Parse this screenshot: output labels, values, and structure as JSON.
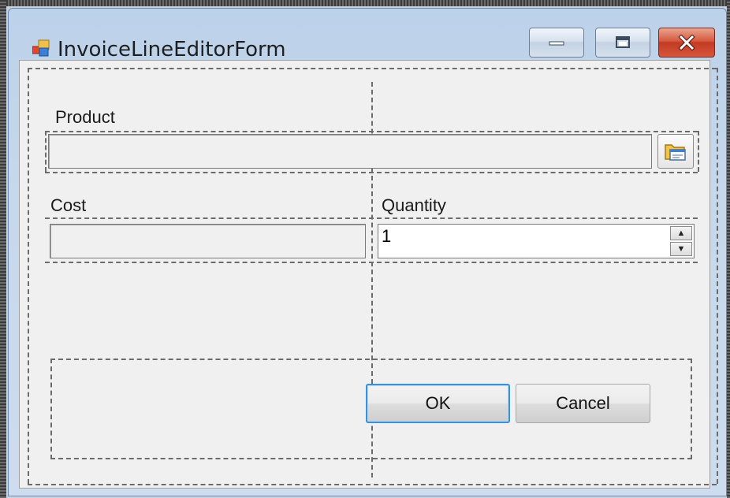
{
  "window": {
    "title": "InvoiceLineEditorForm",
    "controls": {
      "minimize_icon": "minimize-icon",
      "maximize_icon": "maximize-icon",
      "close_icon": "close-icon"
    }
  },
  "form": {
    "product": {
      "label": "Product",
      "value": "",
      "browse_icon": "folder-browse-icon"
    },
    "cost": {
      "label": "Cost",
      "value": ""
    },
    "quantity": {
      "label": "Quantity",
      "value": "1"
    },
    "buttons": {
      "ok_label": "OK",
      "cancel_label": "Cancel"
    }
  },
  "colors": {
    "client_background": "#f0f0f0",
    "close_button": "#c23a22",
    "ok_focus_border": "#3c8fd8"
  }
}
